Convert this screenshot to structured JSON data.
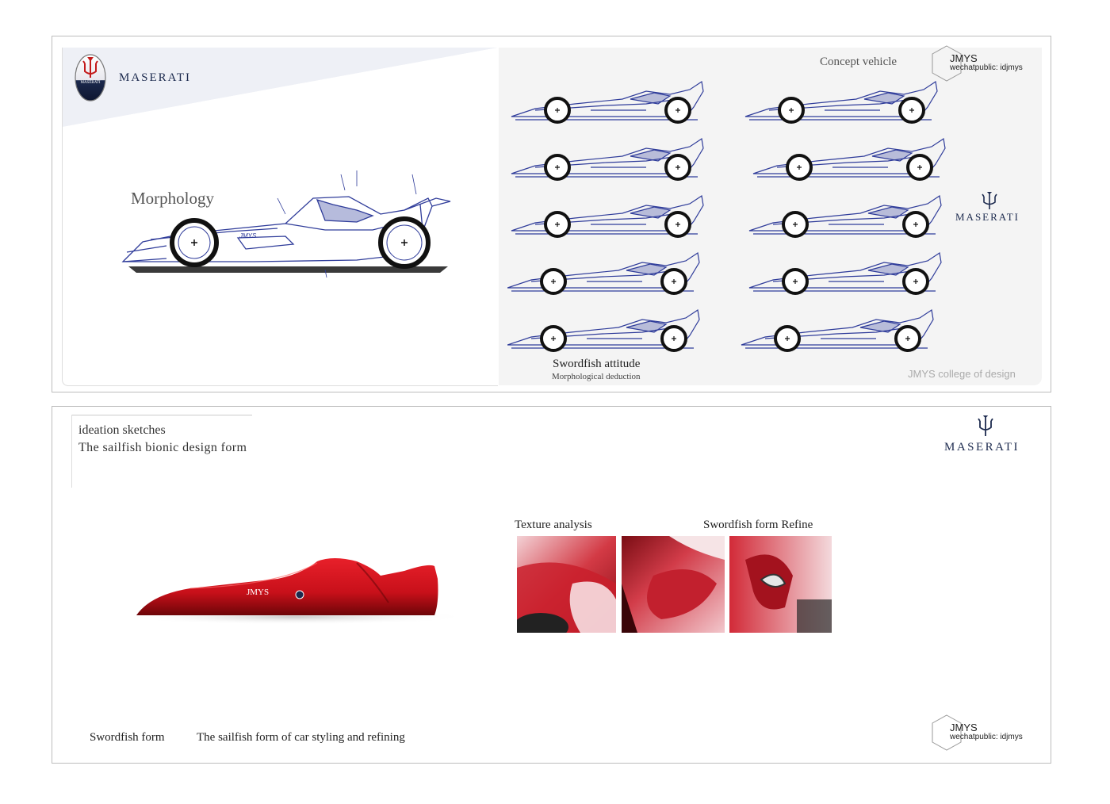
{
  "top": {
    "brand_name": "MASERATI",
    "badge_text": "MASERATI",
    "morphology_label": "Morphology",
    "sketch_label": "JMYS",
    "concept_label": "Concept vehicle",
    "jmys": {
      "title": "JMYS",
      "subtitle": "wechatpublic: idjmys"
    },
    "right_brand": "MASERATI",
    "attitude_title": "Swordfish attitude",
    "attitude_subtitle": "Morphological deduction",
    "college": "JMYS college of design"
  },
  "bottom": {
    "ideation_title": "ideation sketches",
    "ideation_subtitle": "The sailfish bionic design form",
    "brand_name": "MASERATI",
    "render_label": "JMYS",
    "texture_label": "Texture analysis",
    "refine_label": "Swordfish form Refine",
    "caption_left": "Swordfish form",
    "caption_right": "The sailfish form of car styling and refining",
    "jmys": {
      "title": "JMYS",
      "subtitle": "wechatpublic: idjmys"
    }
  },
  "colors": {
    "sketch_blue": "#2f3c9a",
    "render_red": "#c8101a",
    "panel_border": "#bdbdbd",
    "brand_navy": "#1c2a4e"
  }
}
